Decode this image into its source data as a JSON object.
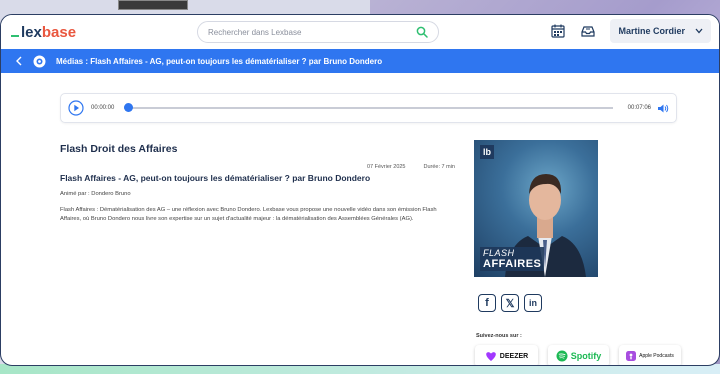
{
  "header": {
    "logo_prefix": "lex",
    "logo_suffix": "base",
    "search_placeholder": "Rechercher dans Lexbase",
    "user_name": "Martine Cordier"
  },
  "breadcrumb": {
    "title": "Médias : Flash Affaires - AG, peut-on toujours les dématérialiser ? par Bruno Dondero"
  },
  "player": {
    "current_time": "00:00:00",
    "total_time": "00:07:06",
    "progress": 0
  },
  "episode": {
    "show_title": "Flash Droit des Affaires",
    "date": "07 Février 2025",
    "duration": "Durée: 7 min",
    "title": "Flash Affaires - AG, peut-on toujours les dématérialiser ? par Bruno Dondero",
    "host": "Animé par : Dondero Bruno",
    "description": "Flash Affaires : Dématérialisation des AG – une réflexion avec Bruno Dondero. Lexbase vous propose une nouvelle vidéo dans son émission Flash Affaires, où Bruno Dondero nous livre son expertise sur un sujet d'actualité majeur : la dématérialisation des Assemblées Générales (AG)."
  },
  "cover": {
    "badge": "lb",
    "line1": "FLASH",
    "line2": "AFFAIRES"
  },
  "socials": {
    "facebook": "f",
    "x": "𝕏",
    "linkedin": "in"
  },
  "follow": {
    "label": "Suivez-nous sur :",
    "deezer": "DEEZER",
    "spotify": "Spotify",
    "apple": "Apple Podcasts"
  },
  "colors": {
    "accent": "#2f76f0",
    "brand": "#1f3a5f",
    "spotify": "#1db954",
    "deezer": "#a238ff"
  }
}
